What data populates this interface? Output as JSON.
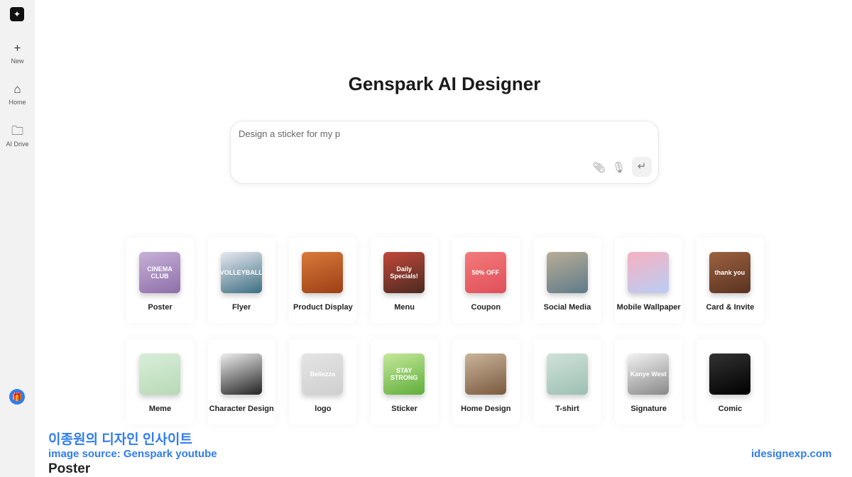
{
  "sidebar": {
    "items": [
      {
        "label": "New",
        "icon": "plus-icon"
      },
      {
        "label": "Home",
        "icon": "home-icon"
      },
      {
        "label": "AI Drive",
        "icon": "folder-icon"
      }
    ]
  },
  "header": {
    "title": "Genspark AI Designer"
  },
  "prompt": {
    "value": "Design a sticker for my p"
  },
  "categories": [
    {
      "label": "Poster",
      "thumb_text": "CINEMA CLUB",
      "colors": [
        "#c6b0d8",
        "#8e6fa8"
      ]
    },
    {
      "label": "Flyer",
      "thumb_text": "VOLLEYBALL",
      "colors": [
        "#e8e8f0",
        "#3c6f82"
      ]
    },
    {
      "label": "Product Display",
      "thumb_text": "",
      "colors": [
        "#d97a3a",
        "#9c3f16"
      ]
    },
    {
      "label": "Menu",
      "thumb_text": "Daily Specials!",
      "colors": [
        "#c2483a",
        "#4a2a20"
      ]
    },
    {
      "label": "Coupon",
      "thumb_text": "50% OFF",
      "colors": [
        "#f37a7a",
        "#e0505a"
      ]
    },
    {
      "label": "Social Media",
      "thumb_text": "",
      "colors": [
        "#b8ad95",
        "#5e7b8a"
      ]
    },
    {
      "label": "Mobile Wallpaper",
      "thumb_text": "",
      "colors": [
        "#f7b1c0",
        "#b9cdf5"
      ]
    },
    {
      "label": "Card & Invite",
      "thumb_text": "thank you",
      "colors": [
        "#9c6240",
        "#5a3220"
      ]
    },
    {
      "label": "Meme",
      "thumb_text": "",
      "colors": [
        "#d9eed8",
        "#b7d9b6"
      ]
    },
    {
      "label": "Character Design",
      "thumb_text": "",
      "colors": [
        "#eeeeee",
        "#222222"
      ]
    },
    {
      "label": "logo",
      "thumb_text": "Bellezza",
      "colors": [
        "#e4e4e4",
        "#cfcfcf"
      ]
    },
    {
      "label": "Sticker",
      "thumb_text": "STAY STRONG",
      "colors": [
        "#c5e89a",
        "#5fae3a"
      ]
    },
    {
      "label": "Home Design",
      "thumb_text": "",
      "colors": [
        "#c9b49a",
        "#7a5a3e"
      ]
    },
    {
      "label": "T-shirt",
      "thumb_text": "",
      "colors": [
        "#cfe2da",
        "#9dbfb2"
      ]
    },
    {
      "label": "Signature",
      "thumb_text": "Kanye West",
      "colors": [
        "#f2f2f2",
        "#888888"
      ]
    },
    {
      "label": "Comic",
      "thumb_text": "",
      "colors": [
        "#333333",
        "#000000"
      ]
    }
  ],
  "watermark": {
    "korean": "이종원의 디자인 인사이트",
    "source": "image source: Genspark youtube",
    "site": "idesignexp.com",
    "caption": "Poster"
  },
  "colors": {
    "accent": "#2f7cf0"
  }
}
